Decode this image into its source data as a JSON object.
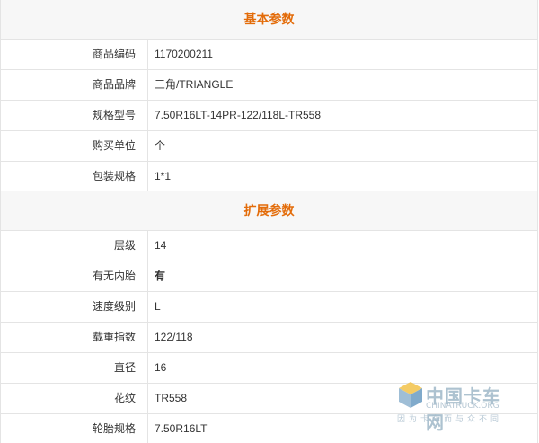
{
  "sections": [
    {
      "title": "基本参数",
      "rows": [
        {
          "label": "商品编码",
          "value": "1170200211"
        },
        {
          "label": "商品品牌",
          "value": "三角/TRIANGLE"
        },
        {
          "label": "规格型号",
          "value": "7.50R16LT-14PR-122/118L-TR558"
        },
        {
          "label": "购买单位",
          "value": "个"
        },
        {
          "label": "包装规格",
          "value": "1*1"
        }
      ]
    },
    {
      "title": "扩展参数",
      "rows": [
        {
          "label": "层级",
          "value": "14"
        },
        {
          "label": "有无内胎",
          "value": "有"
        },
        {
          "label": "速度级别",
          "value": "L"
        },
        {
          "label": "载重指数",
          "value": "122/118"
        },
        {
          "label": "直径",
          "value": "16"
        },
        {
          "label": "花纹",
          "value": "TR558"
        },
        {
          "label": "轮胎规格",
          "value": "7.50R16LT"
        }
      ]
    }
  ],
  "watermark": {
    "name": "中国卡车网",
    "url": "CHINATRUCK.ORG",
    "slogan": "因为卡车而与众不同"
  },
  "colors": {
    "section_title": "#e36c0a",
    "header_bg": "#f7f7f7",
    "border": "#e4e4e4"
  }
}
